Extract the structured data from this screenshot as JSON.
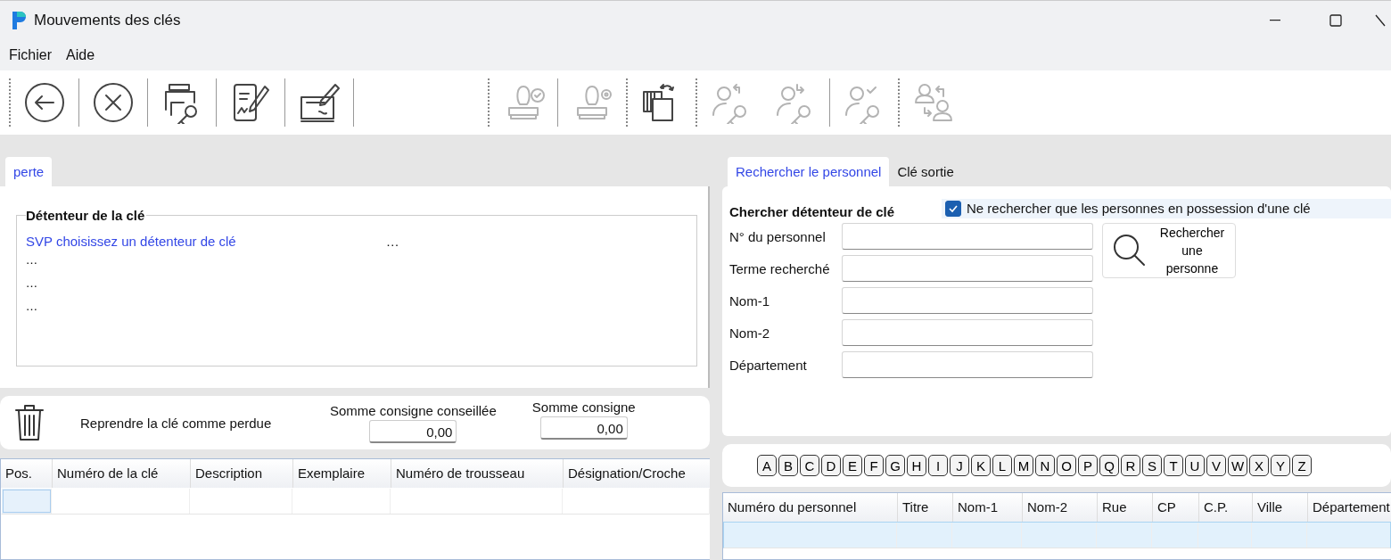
{
  "window": {
    "title": "Mouvements des clés"
  },
  "menu": [
    "Fichier",
    "Aide"
  ],
  "toolbar": [
    {
      "kind": "dotted"
    },
    {
      "kind": "back",
      "disabled": false
    },
    {
      "kind": "line"
    },
    {
      "kind": "cancel",
      "disabled": false
    },
    {
      "kind": "line"
    },
    {
      "kind": "print_key",
      "disabled": false
    },
    {
      "kind": "line"
    },
    {
      "kind": "sign_doc",
      "disabled": false
    },
    {
      "kind": "line"
    },
    {
      "kind": "sign_pad",
      "disabled": false
    },
    {
      "kind": "line"
    },
    {
      "kind": "gap"
    },
    {
      "kind": "dotted"
    },
    {
      "kind": "stamp_check",
      "disabled": true
    },
    {
      "kind": "line"
    },
    {
      "kind": "stamp_gear",
      "disabled": true
    },
    {
      "kind": "dotted"
    },
    {
      "kind": "transfer",
      "disabled": false
    },
    {
      "kind": "dotted"
    },
    {
      "kind": "person_key_in",
      "disabled": true
    },
    {
      "kind": "person_key_out",
      "disabled": true
    },
    {
      "kind": "line"
    },
    {
      "kind": "person_key_check",
      "disabled": true
    },
    {
      "kind": "dotted"
    },
    {
      "kind": "persons_swap",
      "disabled": true
    }
  ],
  "left_tabs": [
    {
      "label": "perte",
      "selected": true
    }
  ],
  "holder": {
    "title": "Détenteur de la clé",
    "prompt": "SVP choisissez un détenteur de clé",
    "prompt_suffix": "…",
    "lines": [
      "…",
      "…",
      "…"
    ]
  },
  "loss": {
    "label": "Reprendre la clé comme perdue",
    "advised": {
      "label": "Somme consigne conseillée",
      "value": "0,00"
    },
    "deposit": {
      "label": "Somme consigne",
      "value": "0,00"
    }
  },
  "keys_table": {
    "columns": [
      "Pos.",
      "Numéro de la clé",
      "Description",
      "Exemplaire",
      "Numéro de trousseau",
      "Désignation/Croche"
    ],
    "rows": [
      {
        "selected": false,
        "focused_cell": true
      }
    ]
  },
  "right_tabs": [
    {
      "label": "Rechercher le personnel",
      "selected": true
    },
    {
      "label": "Clé sortie",
      "selected": false
    }
  ],
  "search": {
    "title": "Chercher détenteur de clé",
    "only_holders": {
      "label": "Ne rechercher que les personnes en possession d'une clé",
      "checked": true
    },
    "fields": [
      {
        "label": "N° du personnel"
      },
      {
        "label": "Terme recherché"
      },
      {
        "label": "Nom-1"
      },
      {
        "label": "Nom-2"
      },
      {
        "label": "Département"
      }
    ],
    "button": "Rechercher une personne"
  },
  "letters": [
    "A",
    "B",
    "C",
    "D",
    "E",
    "F",
    "G",
    "H",
    "I",
    "J",
    "K",
    "L",
    "M",
    "N",
    "O",
    "P",
    "Q",
    "R",
    "S",
    "T",
    "U",
    "V",
    "W",
    "X",
    "Y",
    "Z"
  ],
  "staff_table": {
    "columns": [
      "Numéro du personnel",
      "Titre",
      "Nom-1",
      "Nom-2",
      "Rue",
      "CP",
      "C.P.",
      "Ville",
      "Département"
    ],
    "rows": [
      {
        "selected": true,
        "focused_cell": false
      }
    ]
  }
}
